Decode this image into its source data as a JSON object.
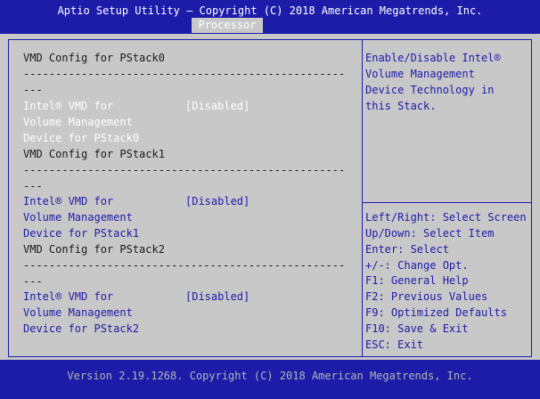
{
  "header": {
    "title": "Aptio Setup Utility – Copyright (C) 2018 American Megatrends, Inc.",
    "active_tab": "Processor"
  },
  "sections": [
    {
      "heading": "VMD Config for PStack0",
      "dashes": "--------------------------------------------------",
      "dashes_tail": "---",
      "option_lines": [
        "Intel® VMD for",
        "Volume Management",
        "Device for PStack0"
      ],
      "value": "[Disabled]"
    },
    {
      "heading": "VMD Config for PStack1",
      "dashes": "--------------------------------------------------",
      "dashes_tail": "---",
      "option_lines": [
        "Intel® VMD for",
        "Volume Management",
        "Device for PStack1"
      ],
      "value": "[Disabled]"
    },
    {
      "heading": "VMD Config for PStack2",
      "dashes": "--------------------------------------------------",
      "dashes_tail": "---",
      "option_lines": [
        "Intel® VMD for",
        "Volume Management",
        "Device for PStack2"
      ],
      "value": "[Disabled]"
    }
  ],
  "help": {
    "description_lines": [
      "Enable/Disable Intel®",
      "Volume Management",
      "Device Technology in",
      "this Stack."
    ],
    "keys": [
      "Left/Right: Select Screen",
      "Up/Down: Select Item",
      "Enter: Select",
      "+/-: Change Opt.",
      "F1: General Help",
      "F2: Previous Values",
      "F9: Optimized Defaults",
      "F10: Save & Exit",
      "ESC: Exit"
    ]
  },
  "footer": {
    "text": "Version 2.19.1268. Copyright (C) 2018 American Megatrends, Inc."
  }
}
